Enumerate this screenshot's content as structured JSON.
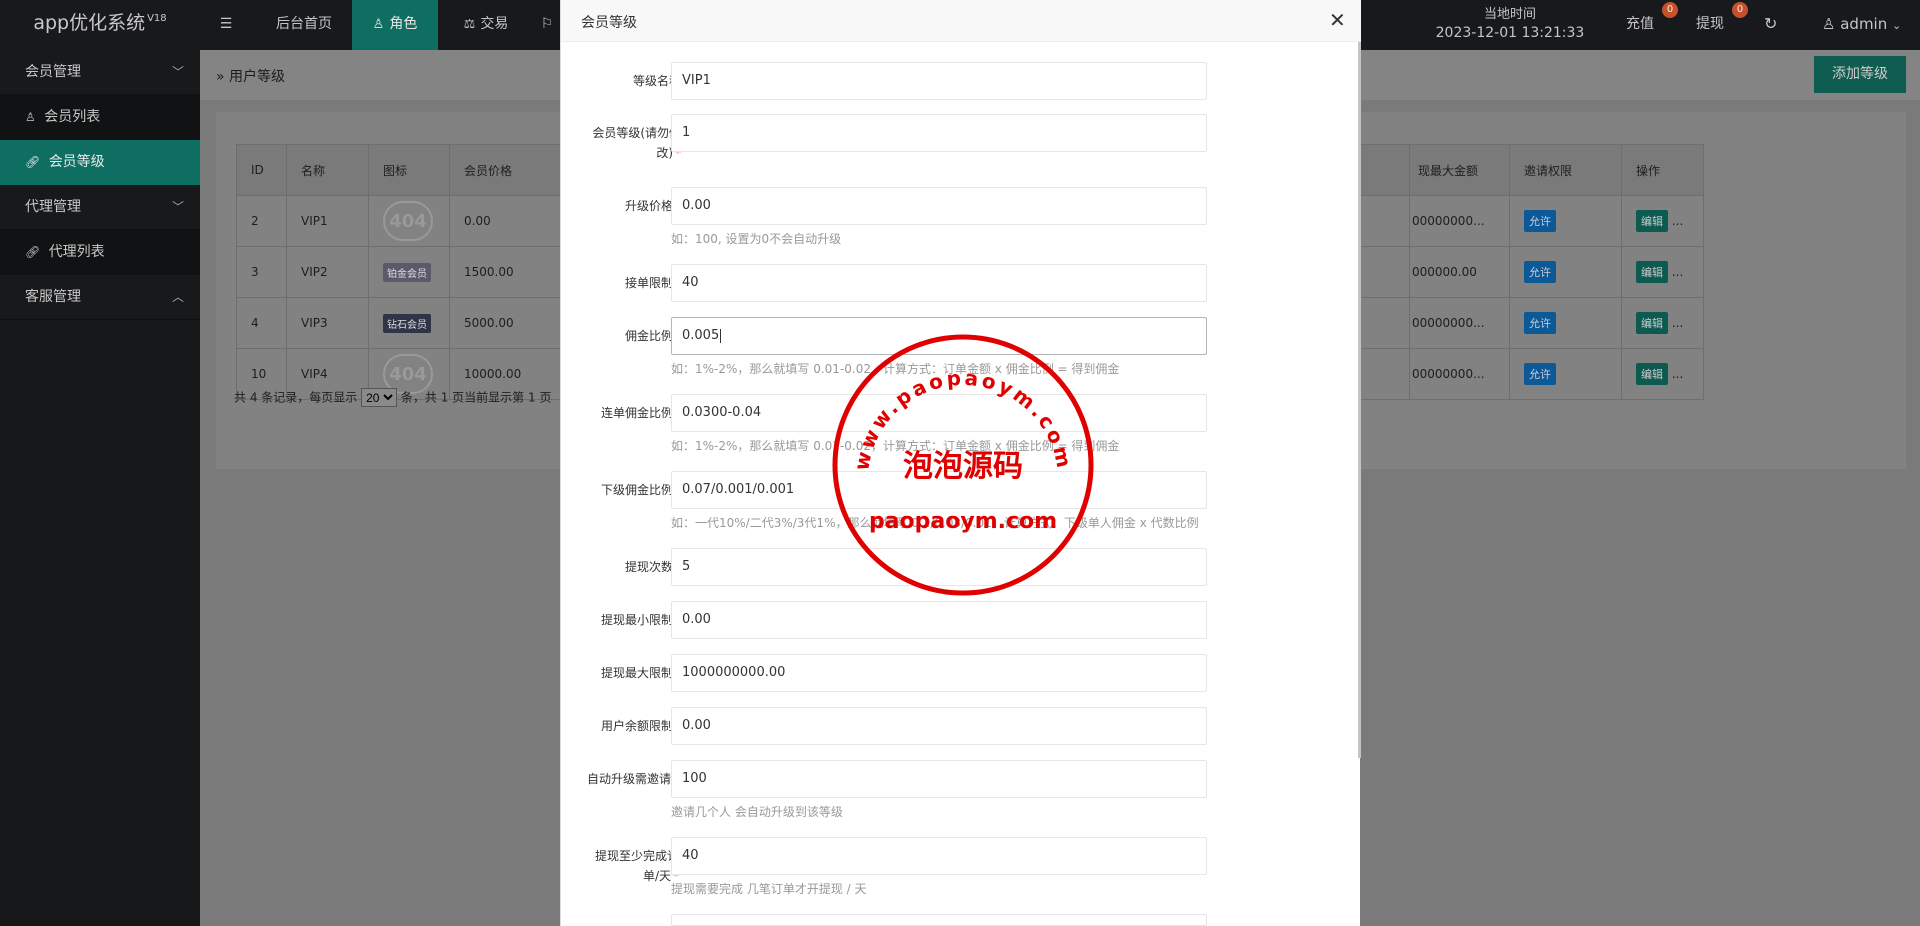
{
  "app": {
    "logo": "app优化系统",
    "version": "V18"
  },
  "topnav": {
    "items": [
      "后台首页",
      "角色",
      "交易",
      "P"
    ],
    "time_label": "当地时间",
    "time_value": "2023-12-01 13:21:33",
    "recharge": "充值",
    "recharge_count": "0",
    "withdraw": "提现",
    "withdraw_count": "0",
    "user": "admin"
  },
  "sidebar": {
    "groups": [
      {
        "label": "会员管理",
        "items": [
          "会员列表",
          "会员等级"
        ]
      },
      {
        "label": "代理管理",
        "items": [
          "代理列表"
        ]
      },
      {
        "label": "客服管理",
        "items": []
      }
    ]
  },
  "page": {
    "breadcrumb": "用户等级",
    "add_button": "添加等级"
  },
  "table": {
    "headers": [
      "ID",
      "名称",
      "图标",
      "会员价格",
      "现最大金额",
      "邀请权限",
      "操作"
    ],
    "rows": [
      {
        "id": "2",
        "name": "VIP1",
        "icon": "404",
        "price": "0.00",
        "max": "00000000...",
        "invite": "允许",
        "op": "编辑"
      },
      {
        "id": "3",
        "name": "VIP2",
        "icon": "铂金会员",
        "price": "1500.00",
        "max": "000000.00",
        "invite": "允许",
        "op": "编辑"
      },
      {
        "id": "4",
        "name": "VIP3",
        "icon": "钻石会员",
        "price": "5000.00",
        "max": "00000000...",
        "invite": "允许",
        "op": "编辑"
      },
      {
        "id": "10",
        "name": "VIP4",
        "icon": "404",
        "price": "10000.00",
        "max": "00000000...",
        "invite": "允许",
        "op": "编辑"
      }
    ],
    "pager_prefix": "共 4 条记录，每页显示",
    "page_size": "20",
    "pager_suffix": "条，共 1 页当前显示第 1 页"
  },
  "modal": {
    "title": "会员等级",
    "fields": [
      {
        "label": "等级名称",
        "required": false,
        "value": "VIP1",
        "hint": ""
      },
      {
        "label": "会员等级(请勿修改)",
        "required": true,
        "value": "1",
        "hint": ""
      },
      {
        "label": "升级价格",
        "required": true,
        "value": "0.00",
        "hint": "如：100, 设置为0不会自动升级"
      },
      {
        "label": "接单限制",
        "required": true,
        "value": "40",
        "hint": ""
      },
      {
        "label": "佣金比例",
        "required": true,
        "value": "0.005",
        "hint": "如：1%-2%，那么就填写 0.01-0.02，计算方式：订单金额 x 佣金比例 = 得到佣金"
      },
      {
        "label": "连单佣金比例",
        "required": true,
        "value": "0.0300-0.04",
        "hint": "如：1%-2%，那么就填写 0.01-0.02，计算方式：订单金额 x 佣金比例 = 得到佣金"
      },
      {
        "label": "下级佣金比例",
        "required": true,
        "value": "0.07/0.001/0.001",
        "hint": "如：一代10%/二代3%/3代1%，那么就填写 0.1/0.03/0.01，计算方式：下级单人佣金 x 代数比例"
      },
      {
        "label": "提现次数",
        "required": true,
        "value": "5",
        "hint": ""
      },
      {
        "label": "提现最小限制",
        "required": true,
        "value": "0.00",
        "hint": ""
      },
      {
        "label": "提现最大限制",
        "required": true,
        "value": "1000000000.00",
        "hint": ""
      },
      {
        "label": "用户余额限制",
        "required": true,
        "value": "0.00",
        "hint": ""
      },
      {
        "label": "自动升级需邀请",
        "required": true,
        "value": "100",
        "hint": "邀请几个人 会自动升级到该等级"
      },
      {
        "label": "提现至少完成订单/天",
        "required": true,
        "value": "40",
        "hint": "提现需要完成 几笔订单才开提现 / 天"
      }
    ]
  },
  "watermark": {
    "top_text": "www.paopaoym.com",
    "center_text": "泡泡源码",
    "bottom_text": "paopaoym.com",
    "color": "#e00000"
  }
}
